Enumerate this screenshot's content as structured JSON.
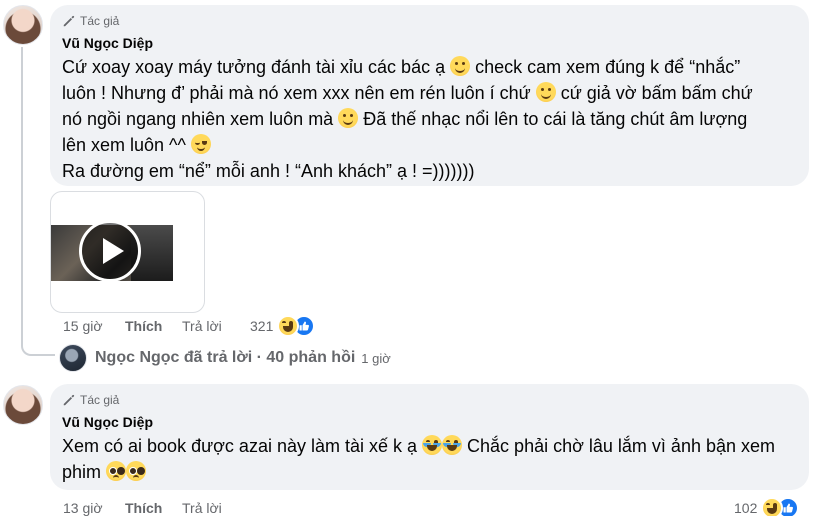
{
  "comments": [
    {
      "author_tag": "Tác giả",
      "author": "Vũ Ngọc Diệp",
      "lines": [
        {
          "a": "Cứ xoay xoay máy tưởng đánh tài xỉu các bác ạ ",
          "b": " check cam xem đúng k để “nhắc”"
        },
        {
          "a": "luôn ! Nhưng đ’ phải mà nó xem xxx nên em rén luôn í chứ ",
          "b": " cứ giả vờ bấm bấm chứ"
        },
        {
          "a": "nó ngồi ngang nhiên xem luôn mà ",
          "b": " Đã thế nhạc nổi lên to cái là tăng chút âm lượng"
        },
        {
          "a": "lên xem luôn ^^ ",
          "b": ""
        },
        {
          "a": "Ra đường em “nể” mỗi anh ! “Anh khách” ạ ! =)))))))",
          "b": ""
        }
      ],
      "time": "15 giờ",
      "like": "Thích",
      "reply": "Trả lời",
      "reaction_count": "321"
    },
    {
      "author_tag": "Tác giả",
      "author": "Vũ Ngọc Diệp",
      "line1": "Xem có ai book được azai này làm tài xế k ạ ",
      "line1b": " Chắc phải chờ lâu lắm vì ảnh bận xem",
      "line2": "phim ",
      "time": "13 giờ",
      "like": "Thích",
      "reply": "Trả lời",
      "reaction_count": "102"
    }
  ],
  "replies_summary": {
    "text": "Ngọc Ngọc đã trả lời · 40 phản hồi",
    "time": "1 giờ"
  },
  "icons": {
    "author_badge": "pen-icon",
    "play": "play-icon",
    "reactions": [
      "haha-icon",
      "like-icon"
    ]
  },
  "colors": {
    "bubble": "#f0f2f5",
    "secondary_text": "#65676b",
    "like_blue": "#1877f2"
  }
}
